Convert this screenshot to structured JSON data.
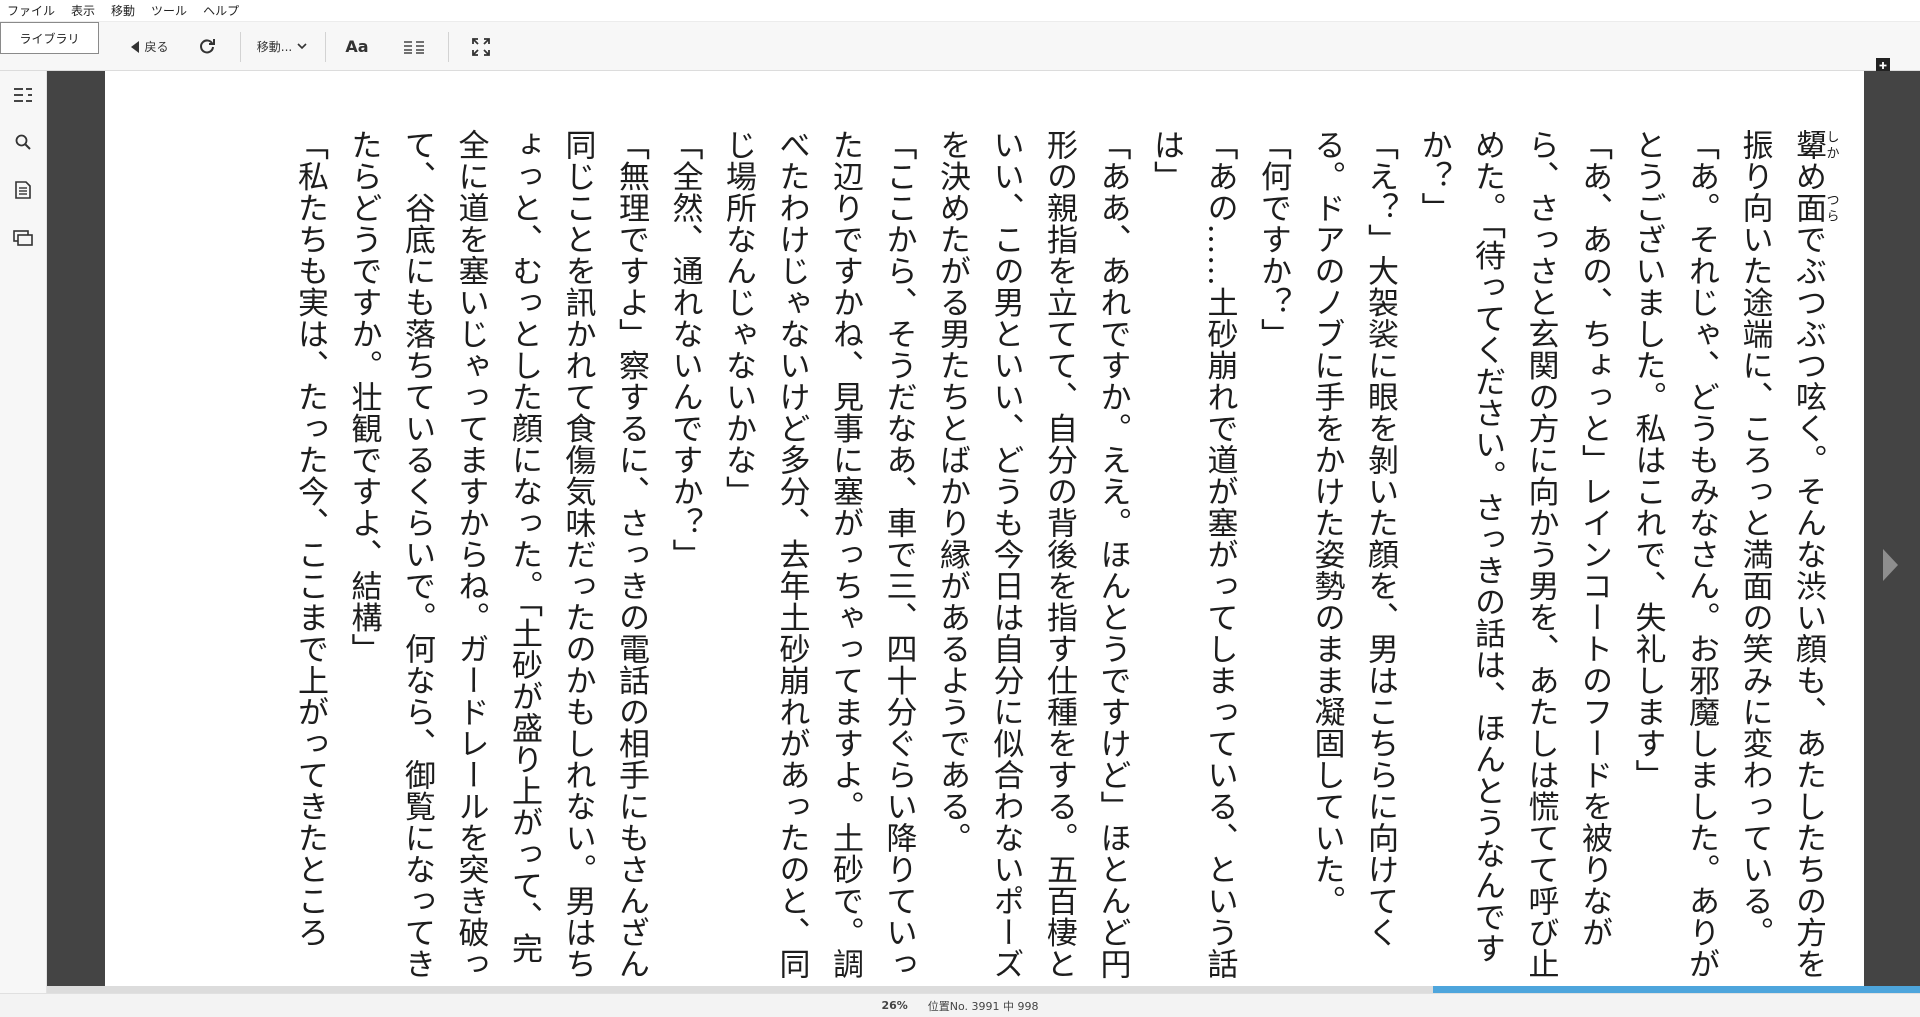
{
  "menu": [
    "ファイル",
    "表示",
    "移動",
    "ツール",
    "ヘルプ"
  ],
  "toolbar": {
    "library_label": "ライブラリ",
    "back_label": "戻る",
    "goto_label": "移動...",
    "font_label": "Aa"
  },
  "book": {
    "paragraphs": [
      "顰め面でぶつぶつ呟く。そんな渋い顔も、あたしたちの方を振り向いた途端に、ころっと満面の笑みに変わっている。",
      "「あ。それじゃ、どうもみなさん。お邪魔しました。ありがとうございました。私はこれで、失礼します」",
      "「あ、あの、ちょっと」レインコートのフードを被りながら、さっさと玄関の方に向かう男を、あたしは慌てて呼び止めた。「待ってください。さっきの話は、ほんとうなんですか？」",
      "「え？」大袈裟に眼を剝いた顔を、男はこちらに向けてくる。ドアのノブに手をかけた姿勢のまま凝固していた。",
      "「何ですか？」",
      "「あの……土砂崩れで道が塞がってしまっている、という話は」",
      "「ああ、あれですか。ええ。ほんとうですけど」ほとんど円形の親指を立てて、自分の背後を指す仕種をする。五百棲といい、この男といい、どうも今日は自分に似合わないポーズを決めたがる男たちとばかり縁があるようである。",
      "「ここから、そうだなあ、車で三、四十分ぐらい降りていった辺りですかね、見事に塞がっちゃってますよ。土砂で。調べたわけじゃないけど多分、去年土砂崩れがあったのと、同じ場所なんじゃないかな」",
      "「全然、通れないんですか？」",
      "「無理ですよ」察するに、さっきの電話の相手にもさんざん同じことを訊かれて食傷気味だったのかもしれない。男はちょっと、むっとした顔になった。「土砂が盛り上がって、完全に道を塞いじゃってますからね。ガードレールを突き破って、谷底にも落ちているくらいで。何なら、御覧になってきたらどうですか。壮観ですよ、結構」",
      "「私たちも実は、たった今、ここまで上がってきたところ"
    ],
    "ruby": [
      {
        "base": "顰",
        "reading": "しか"
      },
      {
        "base": "面",
        "reading": "つら"
      }
    ]
  },
  "status": {
    "percent": "26%",
    "location": "位置No. 3991 中 998"
  },
  "progress": 0.26,
  "colors": {
    "accent": "#4da5dc",
    "gutter": "#444444"
  },
  "icons": [
    "back-arrow-icon",
    "refresh-icon",
    "chevron-down-icon",
    "columns-icon",
    "fullscreen-icon",
    "toc-icon",
    "search-icon",
    "notes-icon",
    "flashcards-icon",
    "bookmark-icon",
    "next-page-icon"
  ]
}
